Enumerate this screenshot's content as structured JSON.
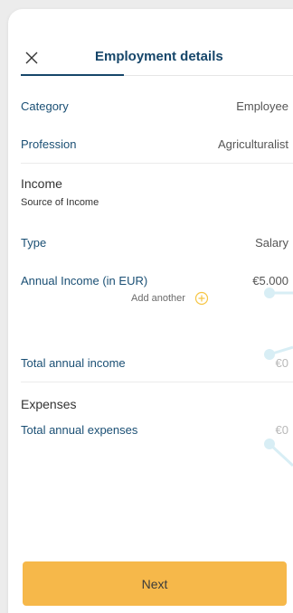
{
  "header": {
    "title": "Employment details"
  },
  "rows": {
    "category": {
      "label": "Category",
      "value": "Employee"
    },
    "profession": {
      "label": "Profession",
      "value": "Agriculturalist"
    }
  },
  "income": {
    "title": "Income",
    "subtitle": "Source of Income",
    "type": {
      "label": "Type",
      "value": "Salary"
    },
    "annual": {
      "label": "Annual Income (in EUR)",
      "value": "€5.000"
    },
    "add_another": "Add another",
    "total": {
      "label": "Total annual income",
      "value": "€0"
    }
  },
  "expenses": {
    "title": "Expenses",
    "total": {
      "label": "Total annual expenses",
      "value": "€0"
    }
  },
  "footer": {
    "next_label": "Next"
  },
  "colors": {
    "accent": "#f6b84a",
    "label": "#1a4f74",
    "slider": "#d8eef5"
  }
}
